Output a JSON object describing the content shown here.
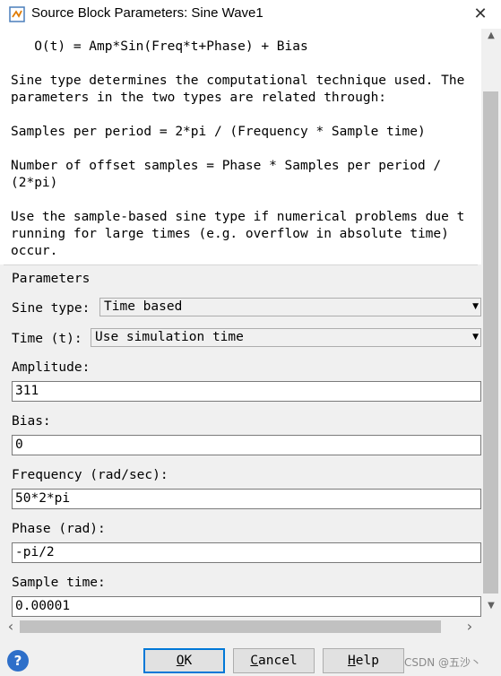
{
  "window": {
    "title": "Source Block Parameters: Sine Wave1",
    "close_label": "✕"
  },
  "description": {
    "lines": [
      "   O(t) = Amp*Sin(Freq*t+Phase) + Bias",
      "Sine type determines the computational technique used. The",
      "parameters in the two types are related through:",
      "Samples per period = 2*pi / (Frequency * Sample time)",
      "Number of offset samples = Phase * Samples per period /",
      "(2*pi)",
      "Use the sample-based sine type if numerical problems due t",
      "running for large times (e.g. overflow in absolute time)",
      "occur."
    ]
  },
  "parameters": {
    "group_title": "Parameters",
    "sine_type": {
      "label": "Sine type:",
      "value": "Time based"
    },
    "time": {
      "label": "Time (t):",
      "value": "Use simulation time"
    },
    "amplitude": {
      "label": "Amplitude:",
      "value": "311"
    },
    "bias": {
      "label": "Bias:",
      "value": "0"
    },
    "frequency": {
      "label": "Frequency (rad/sec):",
      "value": "50*2*pi"
    },
    "phase": {
      "label": "Phase (rad):",
      "value": "-pi/2"
    },
    "sample_time": {
      "label": "Sample time:",
      "value": "0.00001"
    }
  },
  "buttons": {
    "ok": {
      "accel": "O",
      "rest": "K"
    },
    "cancel": {
      "accel": "C",
      "rest": "ancel"
    },
    "help": {
      "accel": "H",
      "rest": "elp"
    }
  },
  "watermark": "CSDN @五沙丶",
  "icons": {
    "app": "simulink-block-icon",
    "help": "help-icon",
    "dropdown": "chevron-down-icon"
  },
  "colors": {
    "default_button_border": "#0078d7",
    "help_icon": "#2e6fc9"
  }
}
